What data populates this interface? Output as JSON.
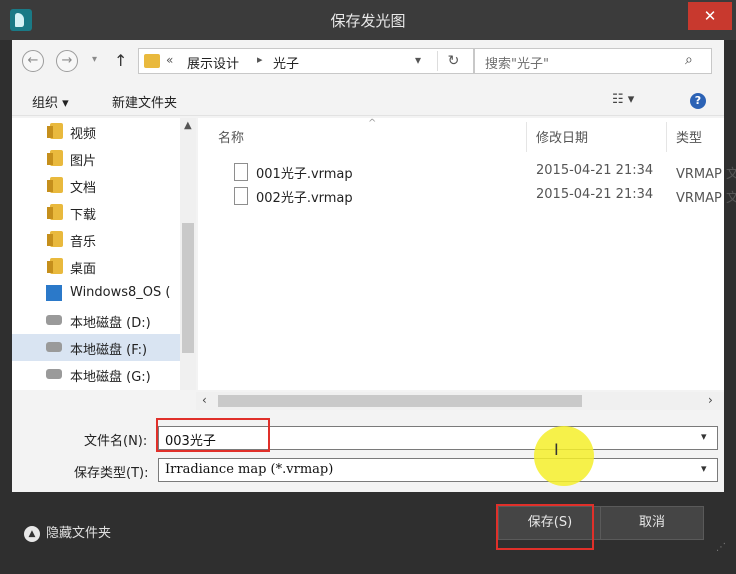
{
  "window": {
    "title": "保存发光图",
    "close_glyph": "✕"
  },
  "address": {
    "back_glyph": "←",
    "forward_glyph": "→",
    "dropdown_glyph": "▾",
    "up_glyph": "↑",
    "chevron": "«",
    "segments": [
      "展示设计",
      "光子"
    ],
    "separator": "▸",
    "refresh_glyph": "↻"
  },
  "search": {
    "placeholder": "搜索\"光子\"",
    "icon": "search-icon",
    "glyph": "⌕"
  },
  "toolbar": {
    "organize_label": "组织 ▾",
    "new_folder_label": "新建文件夹",
    "view_glyph": "☷ ▾",
    "help_glyph": "?"
  },
  "nav": {
    "items": [
      {
        "label": "视频",
        "icon": "folder-icon"
      },
      {
        "label": "图片",
        "icon": "folder-icon"
      },
      {
        "label": "文档",
        "icon": "folder-icon"
      },
      {
        "label": "下载",
        "icon": "folder-icon"
      },
      {
        "label": "音乐",
        "icon": "folder-icon"
      },
      {
        "label": "桌面",
        "icon": "folder-icon"
      },
      {
        "label": "Windows8_OS (",
        "icon": "windows-drive-icon"
      },
      {
        "label": "本地磁盘 (D:)",
        "icon": "drive-icon"
      },
      {
        "label": "本地磁盘 (F:)",
        "icon": "drive-icon",
        "selected": true
      },
      {
        "label": "本地磁盘 (G:)",
        "icon": "drive-icon"
      }
    ],
    "scroll_up_glyph": "▲"
  },
  "files": {
    "columns": [
      "名称",
      "修改日期",
      "类型"
    ],
    "sort_glyph": "^",
    "rows": [
      {
        "name": "001光子.vrmap",
        "date": "2015-04-21 21:34",
        "type": "VRMAP 文"
      },
      {
        "name": "002光子.vrmap",
        "date": "2015-04-21 21:34",
        "type": "VRMAP 文"
      }
    ]
  },
  "hscroll": {
    "left_glyph": "‹",
    "right_glyph": "›"
  },
  "form": {
    "filename_label": "文件名(N):",
    "filename_value": "003光子",
    "filetype_label": "保存类型(T):",
    "filetype_value": "Irradiance map (*.vrmap)",
    "dropdown_glyph": "▾",
    "cursor_glyph": "I"
  },
  "footer": {
    "hide_label": "隐藏文件夹",
    "hide_glyph": "▲",
    "save_label": "保存(S)",
    "cancel_label": "取消",
    "grip_glyph": "⋰"
  },
  "colors": {
    "highlight": "#e0302a",
    "cursor_halo": "#f4ee2a",
    "close": "#c8392e"
  }
}
